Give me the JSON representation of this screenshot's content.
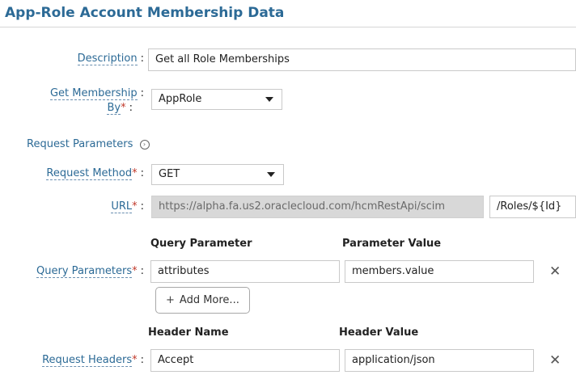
{
  "page": {
    "title": "App-Role Account Membership Data"
  },
  "form": {
    "description": {
      "label": "Description",
      "value": "Get all Role Memberships"
    },
    "get_membership_by": {
      "label_line1": "Get Membership",
      "label_line2": "By",
      "value": "AppRole"
    },
    "request_parameters": {
      "label": "Request Parameters",
      "icon": "chevron-circle-icon"
    },
    "request_method": {
      "label": "Request Method",
      "value": "GET"
    },
    "url": {
      "label": "URL",
      "base": "https://alpha.fa.us2.oraclecloud.com/hcmRestApi/scim",
      "path": "/Roles/${Id}"
    },
    "query_parameters": {
      "label": "Query Parameters",
      "col_param": "Query Parameter",
      "col_value": "Parameter Value",
      "rows": [
        {
          "param": "attributes",
          "value": "members.value"
        }
      ],
      "add_more_label": "Add More..."
    },
    "request_headers": {
      "label": "Request Headers",
      "col_name": "Header Name",
      "col_value": "Header Value",
      "rows": [
        {
          "name": "Accept",
          "value": "application/json"
        }
      ]
    }
  },
  "symbols": {
    "required": "*",
    "colon": ":",
    "remove": "✕",
    "plus": "+",
    "info": "›"
  },
  "colors": {
    "accent": "#2c6a96",
    "required": "#c0392b",
    "readonly_bg": "#d8d8d8"
  }
}
